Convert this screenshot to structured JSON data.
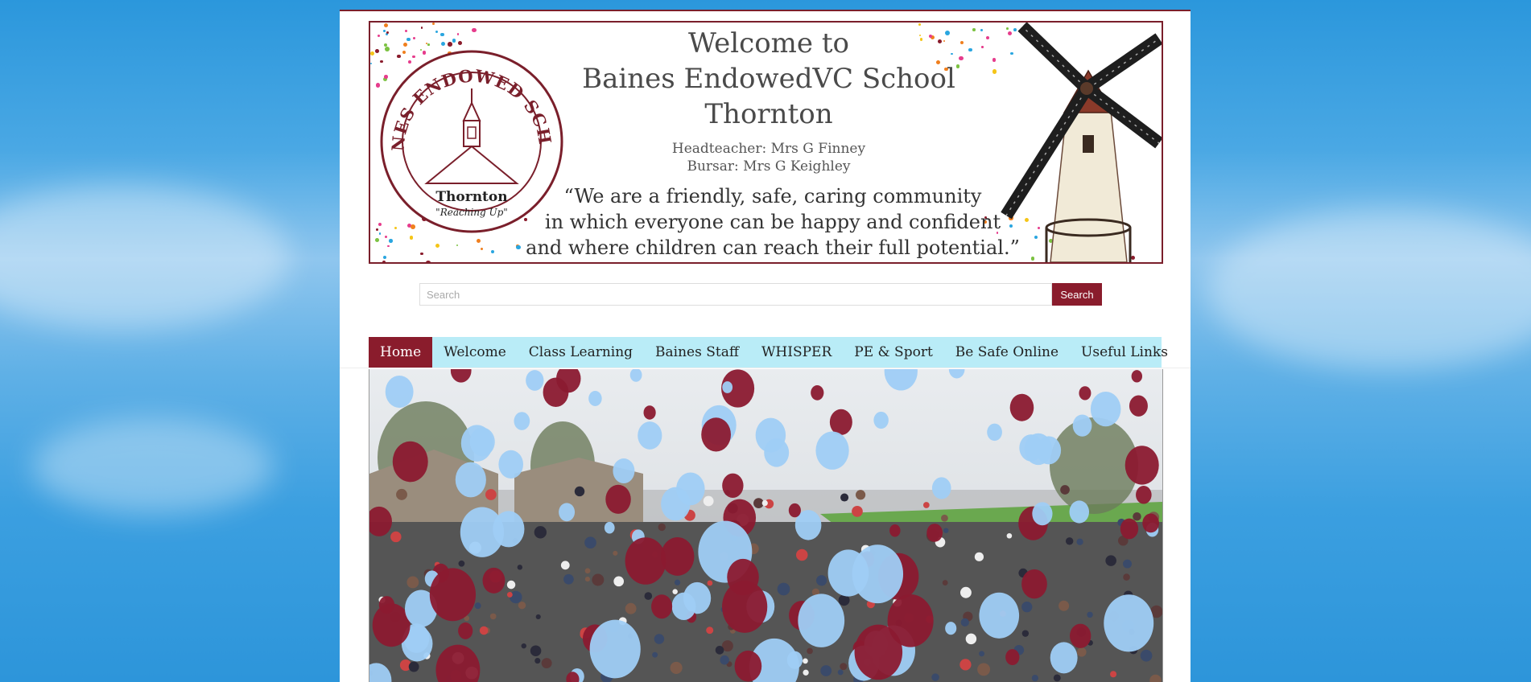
{
  "banner": {
    "title_line1": "Welcome to",
    "title_line2": "Baines EndowedVC School",
    "title_line3": "Thornton",
    "headteacher": "Headteacher: Mrs G Finney",
    "bursar": "Bursar: Mrs G Keighley",
    "motto_line1": "“We are a friendly, safe, caring community",
    "motto_line2": "in which everyone can be happy and confident",
    "motto_line3": "and where children can reach their full potential.”"
  },
  "seal": {
    "arc_text": "BAINES ENDOWED SCHOOL",
    "place": "Thornton",
    "slogan": "\"Reaching Up\""
  },
  "search": {
    "placeholder": "Search",
    "button_label": "Search"
  },
  "nav": {
    "items": [
      {
        "label": "Home",
        "active": true
      },
      {
        "label": "Welcome"
      },
      {
        "label": "Class Learning"
      },
      {
        "label": "Baines Staff"
      },
      {
        "label": "WHISPER"
      },
      {
        "label": "PE & Sport"
      },
      {
        "label": "Be Safe Online"
      },
      {
        "label": "Useful Links"
      }
    ]
  },
  "colors": {
    "brand": "#8a1c2c",
    "nav_bg": "#b9ecf7",
    "sky": "#3b9fe0"
  }
}
